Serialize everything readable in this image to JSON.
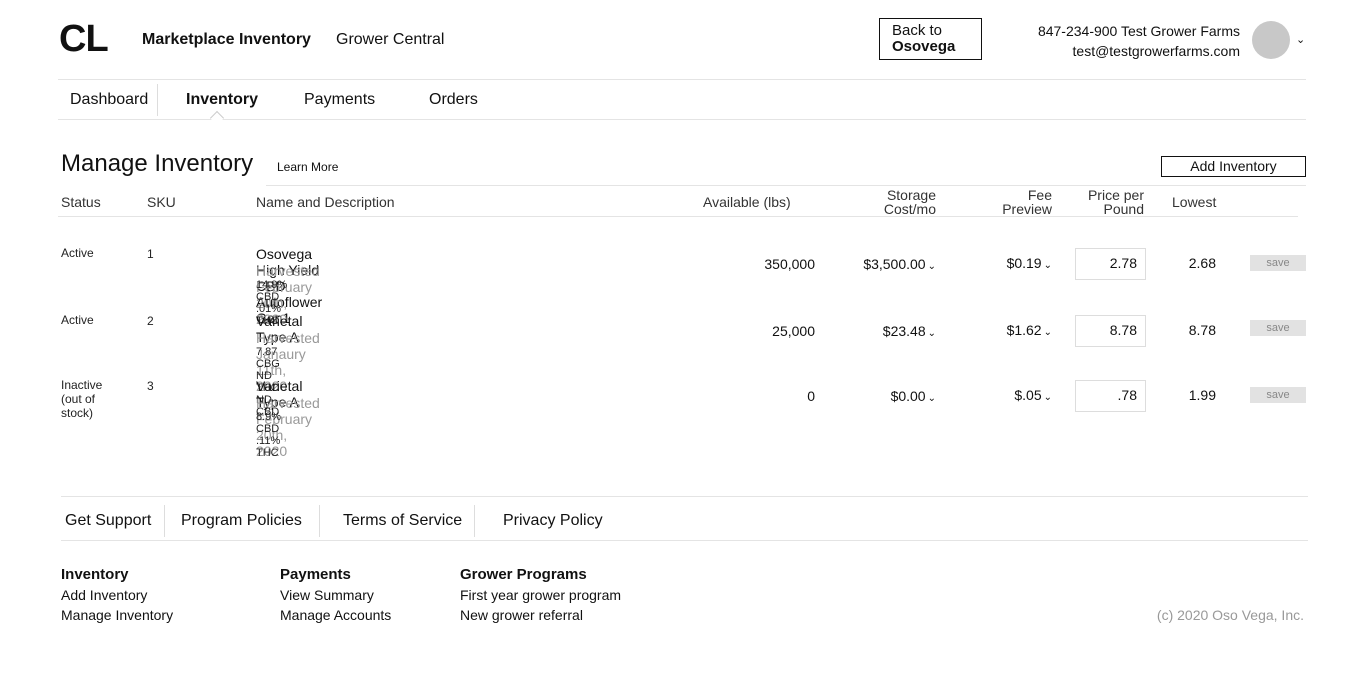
{
  "header": {
    "logo": "CL",
    "nav": [
      "Marketplace Inventory",
      "Grower Central"
    ],
    "back_line1": "Back to",
    "back_line2": "Osovega",
    "account_line1": "847-234-900 Test Grower Farms",
    "account_line2": "test@testgrowerfarms.com",
    "chevron": "⌄"
  },
  "tabs": [
    "Dashboard",
    "Inventory",
    "Payments",
    "Orders"
  ],
  "active_tab": "Inventory",
  "page": {
    "title": "Manage Inventory",
    "learn_more": "Learn More",
    "add_button": "Add Inventory"
  },
  "table": {
    "headers": {
      "status": "Status",
      "sku": "SKU",
      "name": "Name and Description",
      "available": "Available (lbs)",
      "storage_1": "Storage",
      "storage_2": "Cost/mo",
      "fee_1": "Fee",
      "fee_2": "Preview",
      "price_1": "Price per",
      "price_2": "Pound",
      "lowest": "Lowest"
    },
    "rows": [
      {
        "status": "Active",
        "status_note": "",
        "sku": "1",
        "name": "Osovega High Yield CBD Autoflower Gen1",
        "harvested": "Harvested February 20th, 2020",
        "tags": "14.9% CBD   .01% THC",
        "available": "350,000",
        "storage": "$3,500.00",
        "fee": "$0.19",
        "price": "2.78",
        "lowest": "2.68",
        "save": "save"
      },
      {
        "status": "Active",
        "status_note": "",
        "sku": "2",
        "name": "Varietal Type A",
        "harvested": "Harvested Janaury 11th, 2020",
        "tags": "7.87 CBG   ND THC   ND CBD",
        "available": "25,000",
        "storage": "$23.48",
        "fee": "$1.62",
        "price": "8.78",
        "lowest": "8.78",
        "save": "save"
      },
      {
        "status": "Inactive",
        "status_note": "(out of stock)",
        "sku": "3",
        "name": "Varietal Type A",
        "harvested": "Harvested February 20th, 2020",
        "tags": "8.9% CBD   .11% THC",
        "available": "0",
        "storage": "$0.00",
        "fee": "$.05",
        "price": ".78",
        "lowest": "1.99",
        "save": "save"
      }
    ]
  },
  "footer": {
    "links": [
      "Get Support",
      "Program Policies",
      "Terms of Service",
      "Privacy Policy"
    ],
    "columns": [
      {
        "title": "Inventory",
        "items": [
          "Add Inventory",
          "Manage Inventory"
        ]
      },
      {
        "title": "Payments",
        "items": [
          "View Summary",
          "Manage Accounts"
        ]
      },
      {
        "title": "Grower Programs",
        "items": [
          "First year grower program",
          "New grower referral"
        ]
      }
    ],
    "copyright": "(c) 2020 Oso Vega, Inc."
  }
}
